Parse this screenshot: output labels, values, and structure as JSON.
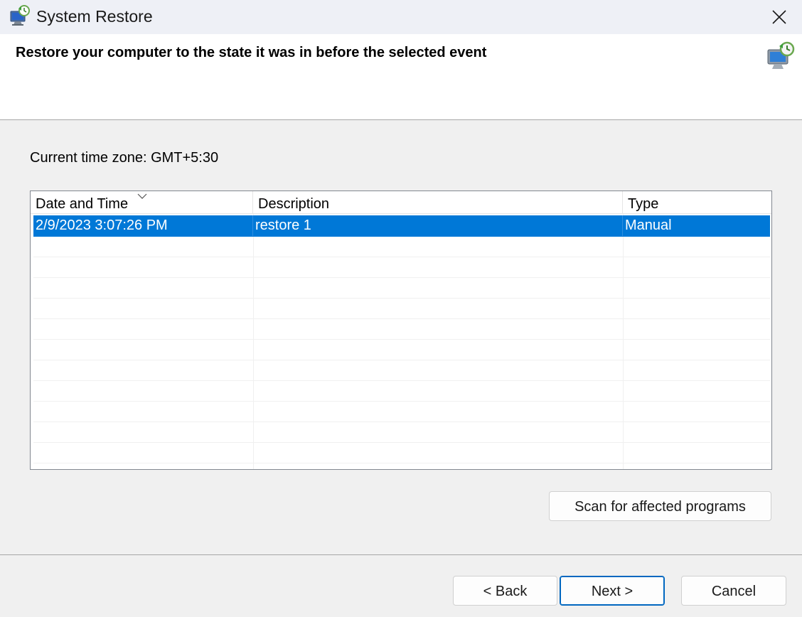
{
  "window": {
    "title": "System Restore",
    "icon": "system-restore-icon",
    "close_icon": "close-icon"
  },
  "header": {
    "title": "Restore your computer to the state it was in before the selected event",
    "icon": "system-restore-icon"
  },
  "timezone_label": "Current time zone: GMT+5:30",
  "list": {
    "columns": [
      "Date and Time",
      "Description",
      "Type"
    ],
    "sort_icon": "chevron-down-icon",
    "rows": [
      {
        "date": "2/9/2023 3:07:26 PM",
        "description": "restore 1",
        "type": "Manual",
        "selected": true
      }
    ]
  },
  "buttons": {
    "scan": "Scan for affected programs",
    "back": "< Back",
    "next": "Next >",
    "cancel": "Cancel"
  },
  "colors": {
    "selection": "#0078d7",
    "default_button_border": "#0067c0"
  }
}
